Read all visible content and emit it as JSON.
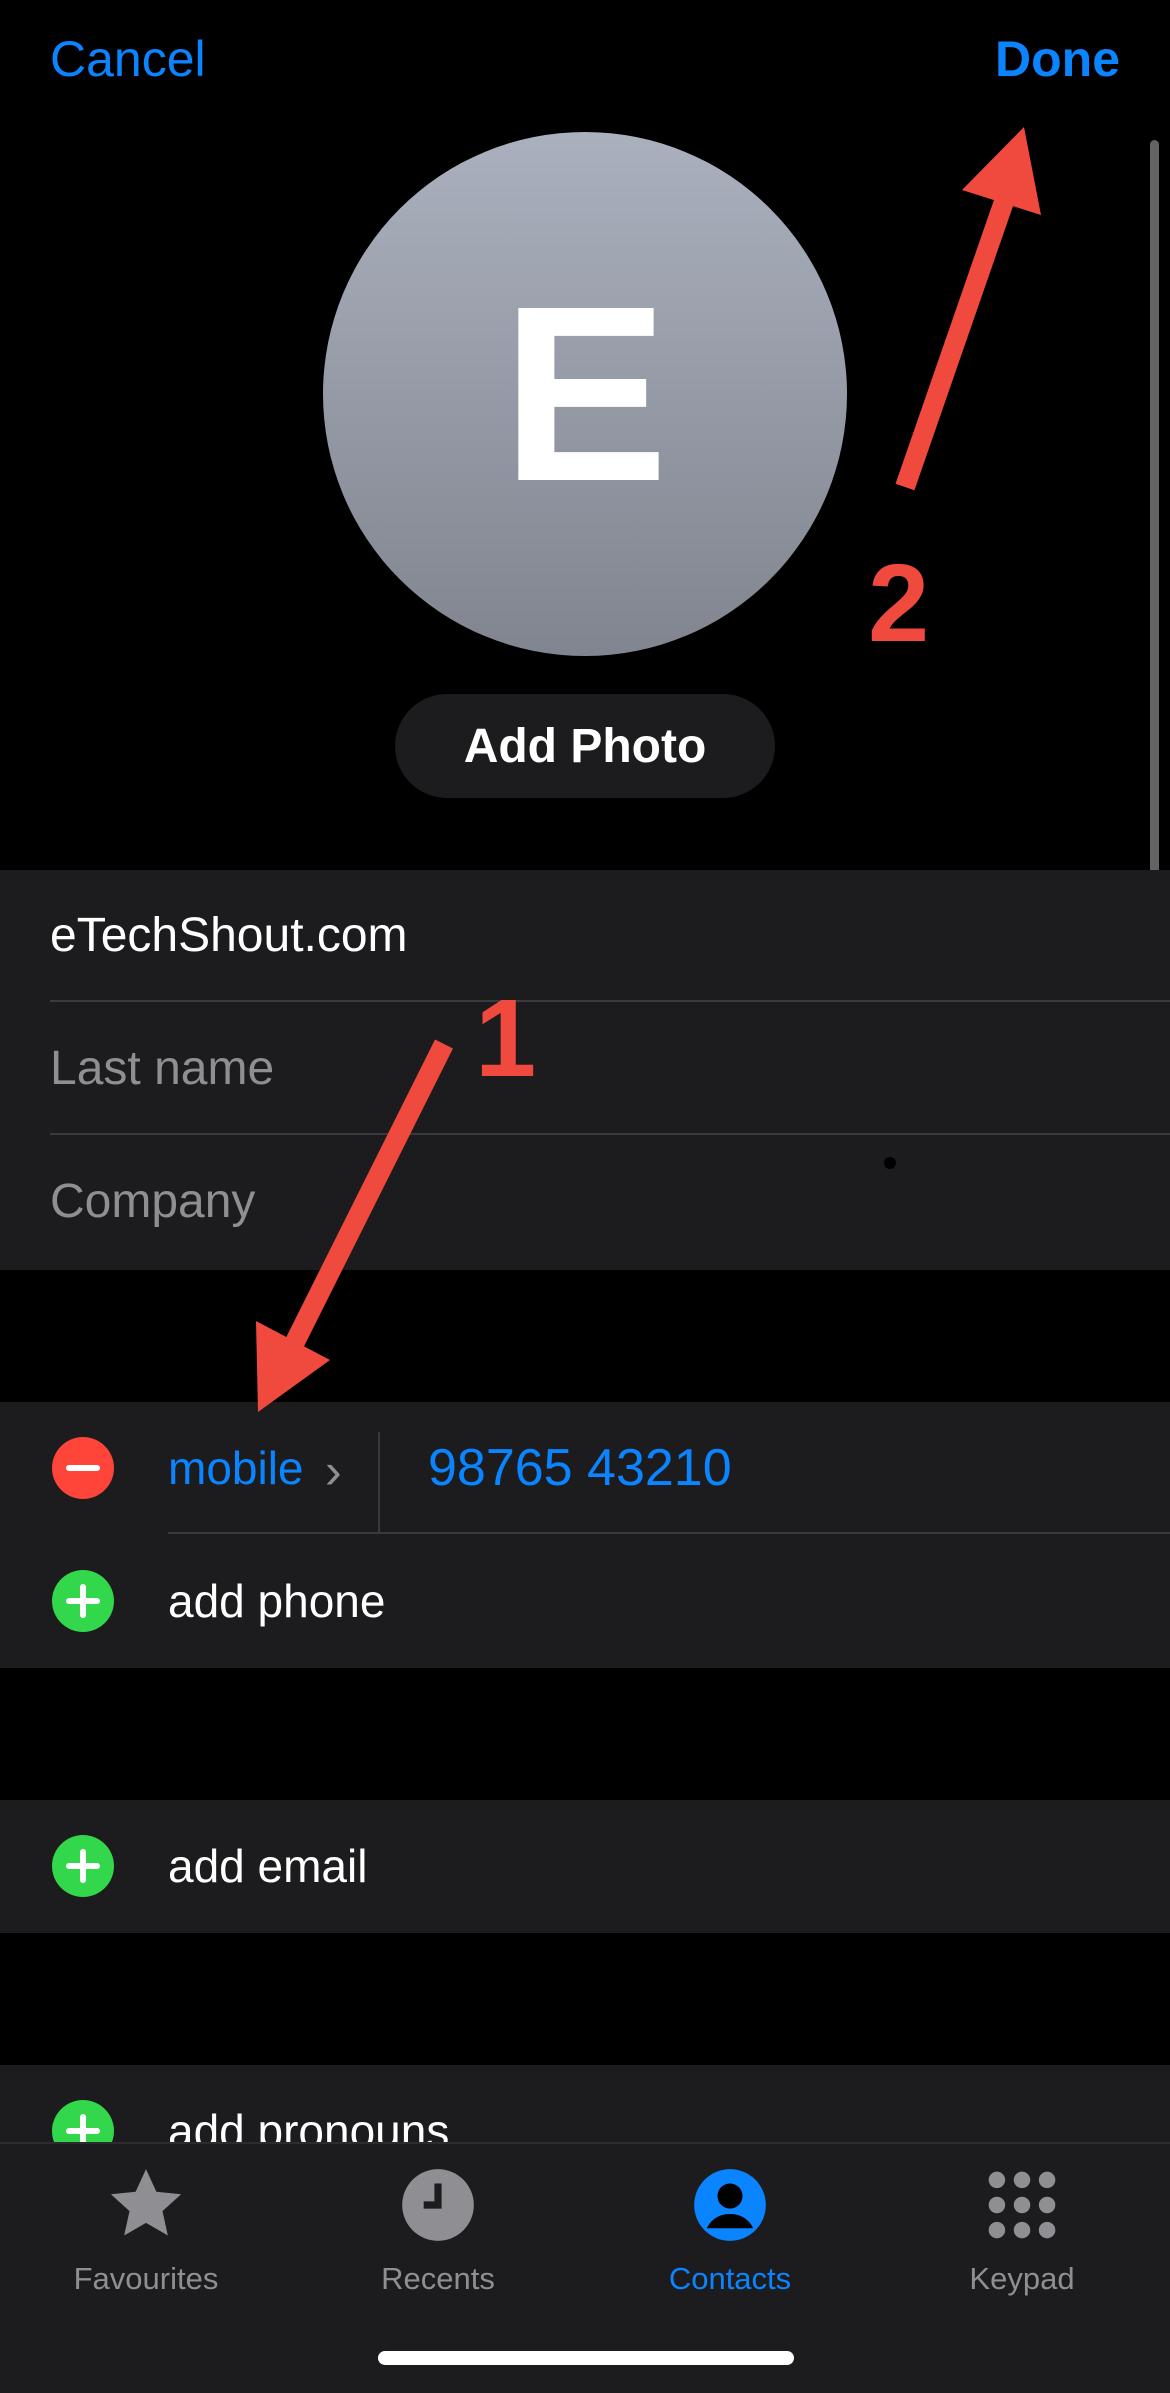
{
  "nav": {
    "cancel": "Cancel",
    "done": "Done"
  },
  "avatar": {
    "initial": "E"
  },
  "add_photo": "Add Photo",
  "name": {
    "first": "eTechShout.com",
    "last_placeholder": "Last name",
    "company_placeholder": "Company"
  },
  "phone": {
    "label": "mobile",
    "number": "98765 43210",
    "add": "add phone"
  },
  "email": {
    "add": "add email"
  },
  "pronouns": {
    "add": "add pronouns"
  },
  "annotations": {
    "one": "1",
    "two": "2"
  },
  "tabs": [
    {
      "label": "Favourites",
      "icon": "star-icon"
    },
    {
      "label": "Recents",
      "icon": "clock-icon"
    },
    {
      "label": "Contacts",
      "icon": "person-circle-icon",
      "active": true
    },
    {
      "label": "Keypad",
      "icon": "keypad-icon"
    }
  ],
  "colors": {
    "accent": "#0A84FF",
    "remove": "#FF453A",
    "add": "#32D74B",
    "annotation": "#F04A3E"
  }
}
